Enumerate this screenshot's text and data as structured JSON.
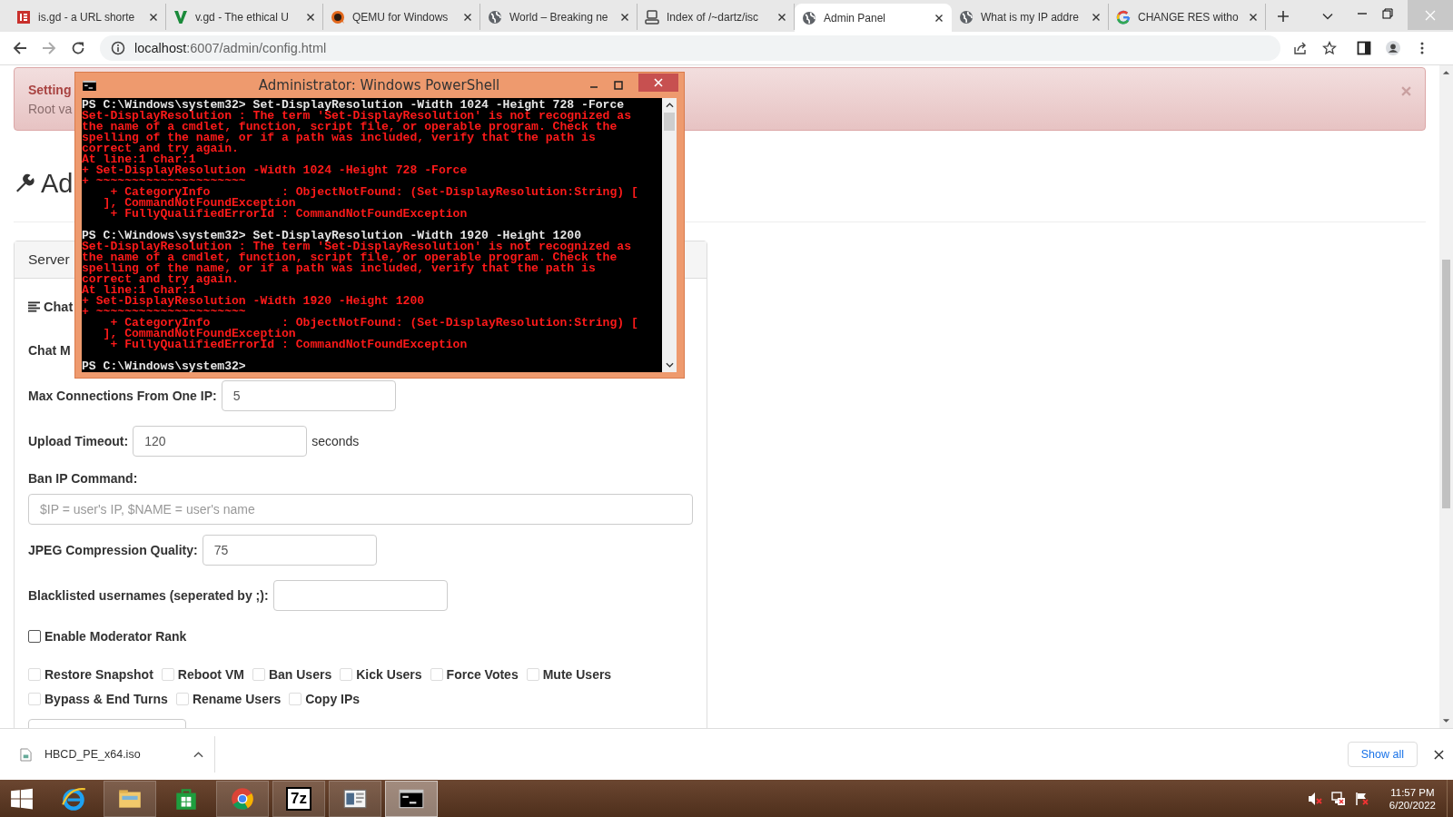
{
  "browser": {
    "tabs": [
      {
        "title": "is.gd - a URL shorte",
        "kind": "isgd",
        "selected": false
      },
      {
        "title": "v.gd - The ethical U",
        "kind": "vgd",
        "selected": false
      },
      {
        "title": "QEMU for Windows",
        "kind": "qemu",
        "selected": false
      },
      {
        "title": "World – Breaking ne",
        "kind": "globe",
        "selected": false
      },
      {
        "title": "Index of /~dartz/isc",
        "kind": "index",
        "selected": false
      },
      {
        "title": "Admin Panel",
        "kind": "globe",
        "selected": true
      },
      {
        "title": "What is my IP addre",
        "kind": "globe",
        "selected": false
      },
      {
        "title": "CHANGE RES witho",
        "kind": "google",
        "selected": false
      }
    ],
    "address": {
      "host": "localhost",
      "path": ":6007/admin/config.html"
    }
  },
  "page": {
    "alert": {
      "title": "Setting",
      "text": "Root va"
    },
    "heading": "Ad",
    "panel": {
      "header": "Server",
      "section": "Chat",
      "rows": [
        {
          "kind": "label",
          "label": "Chat M"
        },
        {
          "kind": "field",
          "label": "Max Connections From One IP:",
          "value": "5"
        },
        {
          "kind": "field",
          "label": "Upload Timeout:",
          "value": "120",
          "suffix": "seconds"
        },
        {
          "kind": "block",
          "label": "Ban IP Command:",
          "placeholder": "$IP = user's IP, $NAME = user's name"
        },
        {
          "kind": "field",
          "label": "JPEG Compression Quality:",
          "value": "75"
        },
        {
          "kind": "field",
          "label": "Blacklisted usernames (seperated by ;):"
        },
        {
          "kind": "checkbox",
          "label": "Enable Moderator Rank",
          "checked": false,
          "disabled": false
        }
      ],
      "permissions": [
        {
          "label": "Restore Snapshot",
          "checked": false,
          "disabled": true
        },
        {
          "label": "Reboot VM",
          "checked": false,
          "disabled": true
        },
        {
          "label": "Ban Users",
          "checked": false,
          "disabled": true
        },
        {
          "label": "Kick Users",
          "checked": false,
          "disabled": true
        },
        {
          "label": "Force Votes",
          "checked": false,
          "disabled": true
        },
        {
          "label": "Mute Users",
          "checked": false,
          "disabled": true
        },
        {
          "label": "Bypass & End Turns",
          "checked": false,
          "disabled": true
        },
        {
          "label": "Rename Users",
          "checked": false,
          "disabled": true
        },
        {
          "label": "Copy IPs",
          "checked": false,
          "disabled": true
        }
      ]
    }
  },
  "powershell": {
    "title": "Administrator: Windows PowerShell",
    "lines": [
      {
        "kind": "command",
        "text": "PS C:\\Windows\\system32> Set-DisplayResolution -Width 1024 -Height 728 -Force"
      },
      {
        "kind": "error",
        "text": "Set-DisplayResolution : The term 'Set-DisplayResolution' is not recognized as"
      },
      {
        "kind": "error",
        "text": "the name of a cmdlet, function, script file, or operable program. Check the"
      },
      {
        "kind": "error",
        "text": "spelling of the name, or if a path was included, verify that the path is"
      },
      {
        "kind": "error",
        "text": "correct and try again."
      },
      {
        "kind": "error",
        "text": "At line:1 char:1"
      },
      {
        "kind": "error",
        "text": "+ Set-DisplayResolution -Width 1024 -Height 728 -Force"
      },
      {
        "kind": "error",
        "text": "+ ~~~~~~~~~~~~~~~~~~~~~"
      },
      {
        "kind": "error",
        "text": "    + CategoryInfo          : ObjectNotFound: (Set-DisplayResolution:String) ["
      },
      {
        "kind": "error",
        "text": "   ], CommandNotFoundException"
      },
      {
        "kind": "error",
        "text": "    + FullyQualifiedErrorId : CommandNotFoundException"
      },
      {
        "kind": "gap"
      },
      {
        "kind": "command",
        "text": "PS C:\\Windows\\system32> Set-DisplayResolution -Width 1920 -Height 1200"
      },
      {
        "kind": "error",
        "text": "Set-DisplayResolution : The term 'Set-DisplayResolution' is not recognized as"
      },
      {
        "kind": "error",
        "text": "the name of a cmdlet, function, script file, or operable program. Check the"
      },
      {
        "kind": "error",
        "text": "spelling of the name, or if a path was included, verify that the path is"
      },
      {
        "kind": "error",
        "text": "correct and try again."
      },
      {
        "kind": "error",
        "text": "At line:1 char:1"
      },
      {
        "kind": "error",
        "text": "+ Set-DisplayResolution -Width 1920 -Height 1200"
      },
      {
        "kind": "error",
        "text": "+ ~~~~~~~~~~~~~~~~~~~~~"
      },
      {
        "kind": "error",
        "text": "    + CategoryInfo          : ObjectNotFound: (Set-DisplayResolution:String) ["
      },
      {
        "kind": "error",
        "text": "   ], CommandNotFoundException"
      },
      {
        "kind": "error",
        "text": "    + FullyQualifiedErrorId : CommandNotFoundException"
      },
      {
        "kind": "gap"
      },
      {
        "kind": "command",
        "text": "PS C:\\Windows\\system32>"
      }
    ]
  },
  "downloads": {
    "file": "HBCD_PE_x64.iso",
    "show_all": "Show all"
  },
  "taskbar": {
    "apps": [
      {
        "kind": "ie",
        "running": false,
        "selected": false
      },
      {
        "kind": "explorer",
        "running": true,
        "selected": false
      },
      {
        "kind": "store",
        "running": false,
        "selected": false
      },
      {
        "kind": "chrome",
        "running": true,
        "selected": false
      },
      {
        "kind": "archiver",
        "label": "7z",
        "running": true,
        "selected": false
      },
      {
        "kind": "reader",
        "running": true,
        "selected": false
      },
      {
        "kind": "console",
        "running": true,
        "selected": true
      }
    ],
    "time": "11:57 PM",
    "date": "6/20/2022"
  }
}
